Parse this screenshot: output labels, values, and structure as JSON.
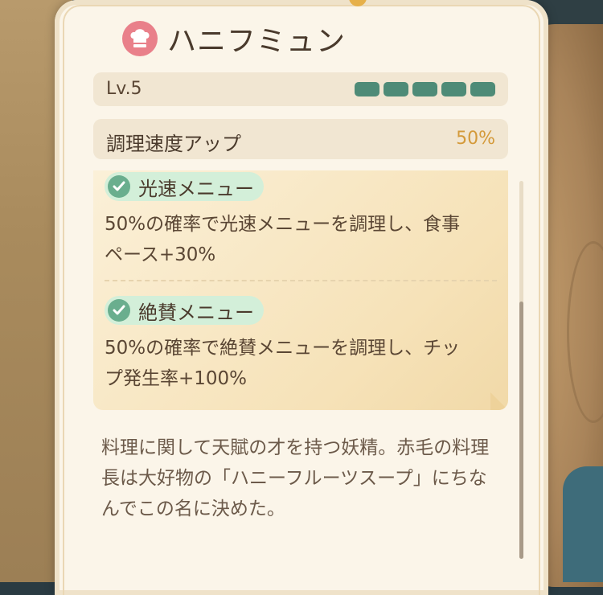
{
  "character": {
    "name": "ハニフミュン",
    "icon": "chef-hat-icon",
    "level_label": "Lv.5",
    "level_pips_filled": 5,
    "level_pips_total": 5,
    "stat": {
      "label": "調理速度アップ",
      "value": "50%"
    }
  },
  "skills": [
    {
      "name": "光速メニュー",
      "icon": "check-icon",
      "description": "50%の確率で光速メニューを調理し、食事ペース+30%"
    },
    {
      "name": "絶賛メニュー",
      "icon": "check-icon",
      "description": "50%の確率で絶賛メニューを調理し、チップ発生率+100%"
    }
  ],
  "description": "料理に関して天賦の才を持つ妖精。赤毛の料理長は大好物の「ハニーフルーツスープ」にちなんでこの名に決めた。",
  "colors": {
    "pip": "#4e8b77",
    "stat_value": "#d49a3a",
    "skill_pill": "#d3efd9",
    "check": "#6aae8e"
  }
}
